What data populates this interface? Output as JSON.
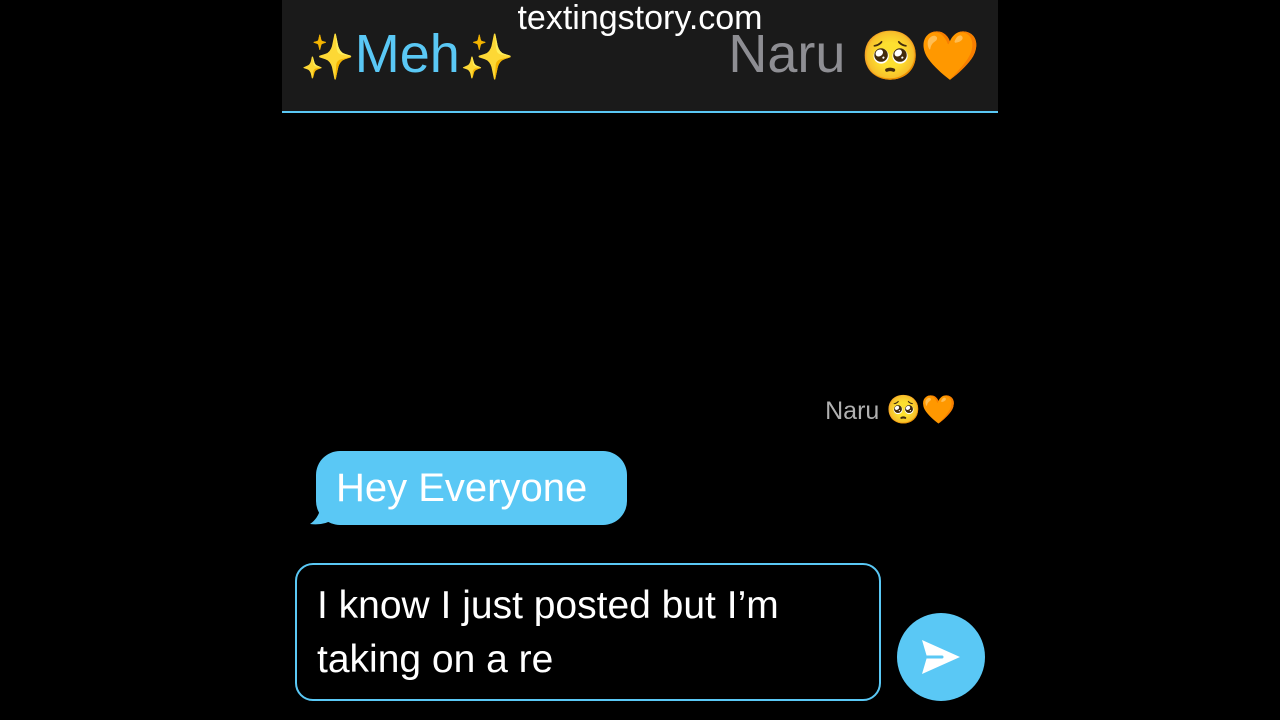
{
  "header": {
    "watermark": "textingstory.com",
    "me_sparkle_left": "✨",
    "me_name": "Meh",
    "me_sparkle_right": "✨",
    "other_name": "Naru",
    "other_emoji_1": "🥺",
    "other_emoji_2": "🧡"
  },
  "thread": {
    "sender_name": "Naru",
    "sender_emoji_1": "🥺",
    "sender_emoji_2": "🧡",
    "messages": [
      {
        "text": "Hey Everyone"
      }
    ]
  },
  "composer": {
    "value": "I know I just posted but I’m\ntaking on a re"
  },
  "icons": {
    "send": "send-arrow-icon"
  },
  "colors": {
    "accent": "#5ac8f5",
    "background": "#000000",
    "header_background": "#1a1a1a",
    "muted_text": "#8e8e93"
  }
}
